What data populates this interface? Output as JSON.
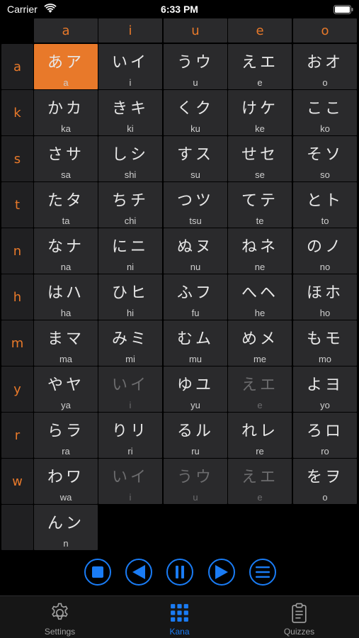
{
  "status": {
    "carrier": "Carrier",
    "time": "6:33 PM"
  },
  "columns": [
    "a",
    "i",
    "u",
    "e",
    "o"
  ],
  "rows": [
    {
      "label": "a",
      "cells": [
        {
          "kana": "あア",
          "romaji": "a",
          "selected": true
        },
        {
          "kana": "いイ",
          "romaji": "i"
        },
        {
          "kana": "うウ",
          "romaji": "u"
        },
        {
          "kana": "えエ",
          "romaji": "e"
        },
        {
          "kana": "おオ",
          "romaji": "o"
        }
      ]
    },
    {
      "label": "k",
      "cells": [
        {
          "kana": "かカ",
          "romaji": "ka"
        },
        {
          "kana": "きキ",
          "romaji": "ki"
        },
        {
          "kana": "くク",
          "romaji": "ku"
        },
        {
          "kana": "けケ",
          "romaji": "ke"
        },
        {
          "kana": "ここ",
          "romaji": "ko"
        }
      ]
    },
    {
      "label": "s",
      "cells": [
        {
          "kana": "さサ",
          "romaji": "sa"
        },
        {
          "kana": "しシ",
          "romaji": "shi"
        },
        {
          "kana": "すス",
          "romaji": "su"
        },
        {
          "kana": "せセ",
          "romaji": "se"
        },
        {
          "kana": "そソ",
          "romaji": "so"
        }
      ]
    },
    {
      "label": "t",
      "cells": [
        {
          "kana": "たタ",
          "romaji": "ta"
        },
        {
          "kana": "ちチ",
          "romaji": "chi"
        },
        {
          "kana": "つツ",
          "romaji": "tsu"
        },
        {
          "kana": "てテ",
          "romaji": "te"
        },
        {
          "kana": "とト",
          "romaji": "to"
        }
      ]
    },
    {
      "label": "n",
      "cells": [
        {
          "kana": "なナ",
          "romaji": "na"
        },
        {
          "kana": "にニ",
          "romaji": "ni"
        },
        {
          "kana": "ぬヌ",
          "romaji": "nu"
        },
        {
          "kana": "ねネ",
          "romaji": "ne"
        },
        {
          "kana": "のノ",
          "romaji": "no"
        }
      ]
    },
    {
      "label": "h",
      "cells": [
        {
          "kana": "はハ",
          "romaji": "ha"
        },
        {
          "kana": "ひヒ",
          "romaji": "hi"
        },
        {
          "kana": "ふフ",
          "romaji": "fu"
        },
        {
          "kana": "へヘ",
          "romaji": "he"
        },
        {
          "kana": "ほホ",
          "romaji": "ho"
        }
      ]
    },
    {
      "label": "m",
      "cells": [
        {
          "kana": "まマ",
          "romaji": "ma"
        },
        {
          "kana": "みミ",
          "romaji": "mi"
        },
        {
          "kana": "むム",
          "romaji": "mu"
        },
        {
          "kana": "めメ",
          "romaji": "me"
        },
        {
          "kana": "もモ",
          "romaji": "mo"
        }
      ]
    },
    {
      "label": "y",
      "cells": [
        {
          "kana": "やヤ",
          "romaji": "ya"
        },
        {
          "kana": "いイ",
          "romaji": "i",
          "dim": true
        },
        {
          "kana": "ゆユ",
          "romaji": "yu"
        },
        {
          "kana": "えエ",
          "romaji": "e",
          "dim": true
        },
        {
          "kana": "よヨ",
          "romaji": "yo"
        }
      ]
    },
    {
      "label": "r",
      "cells": [
        {
          "kana": "らラ",
          "romaji": "ra"
        },
        {
          "kana": "りリ",
          "romaji": "ri"
        },
        {
          "kana": "るル",
          "romaji": "ru"
        },
        {
          "kana": "れレ",
          "romaji": "re"
        },
        {
          "kana": "ろロ",
          "romaji": "ro"
        }
      ]
    },
    {
      "label": "w",
      "cells": [
        {
          "kana": "わワ",
          "romaji": "wa"
        },
        {
          "kana": "いイ",
          "romaji": "i",
          "dim": true
        },
        {
          "kana": "うウ",
          "romaji": "u",
          "dim": true
        },
        {
          "kana": "えエ",
          "romaji": "e",
          "dim": true
        },
        {
          "kana": "をヲ",
          "romaji": "o"
        }
      ]
    },
    {
      "label": "",
      "cells": [
        {
          "kana": "んン",
          "romaji": "n"
        }
      ]
    }
  ],
  "controls": [
    "stop-icon",
    "previous-icon",
    "pause-icon",
    "next-icon",
    "list-icon"
  ],
  "colors": {
    "accent": "#e8792a",
    "tint": "#1a7cf5"
  },
  "tabs": [
    {
      "label": "Settings",
      "icon": "gear-icon",
      "active": false
    },
    {
      "label": "Kana",
      "icon": "grid-icon",
      "active": true
    },
    {
      "label": "Quizzes",
      "icon": "clipboard-icon",
      "active": false
    }
  ]
}
